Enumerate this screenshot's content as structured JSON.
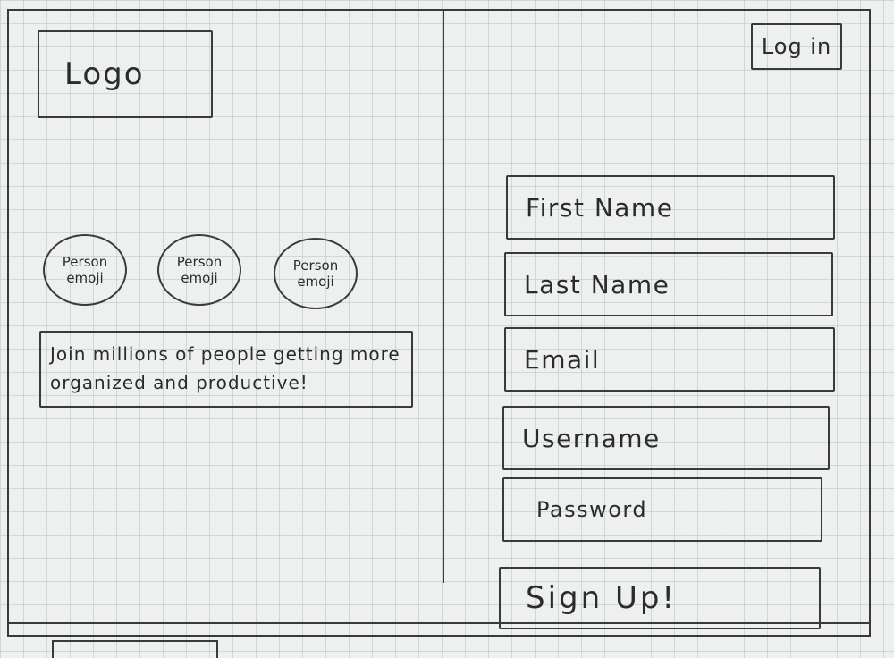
{
  "header": {
    "logo_text": "Logo",
    "login_label": "Log in"
  },
  "hero": {
    "avatars": [
      {
        "line1": "Person",
        "line2": "emoji"
      },
      {
        "line1": "Person",
        "line2": "emoji"
      },
      {
        "line1": "Person",
        "line2": "emoji"
      }
    ],
    "tagline": "Join millions of people getting more organized and productive!"
  },
  "signup_form": {
    "first_name_placeholder": "First Name",
    "last_name_placeholder": "Last Name",
    "email_placeholder": "Email",
    "username_placeholder": "Username",
    "password_placeholder": "Password",
    "submit_label": "Sign Up!"
  }
}
